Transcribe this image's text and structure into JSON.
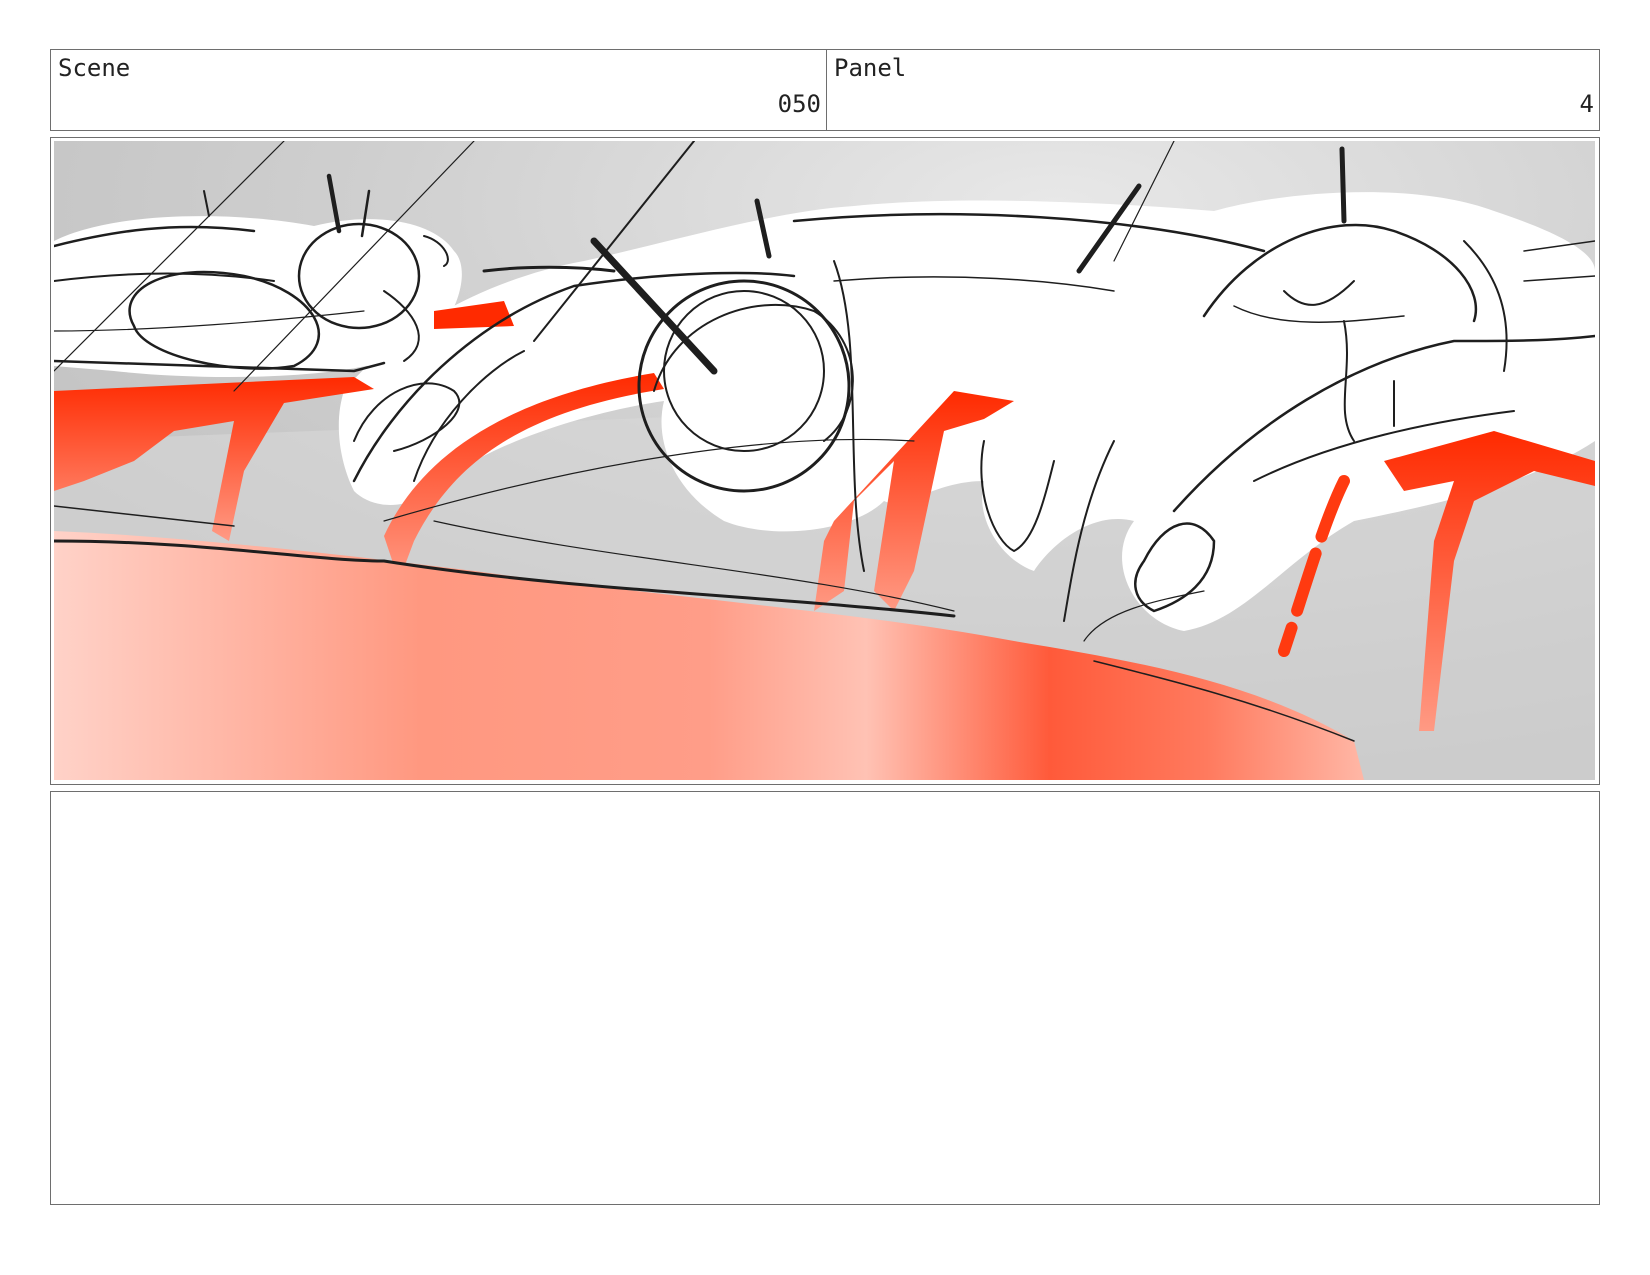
{
  "header": {
    "scene_label": "Scene",
    "scene_value": "050",
    "panel_label": "Panel",
    "panel_value": "4"
  },
  "colors": {
    "border": "#6e6e6e",
    "blood_red": "#ff2a00",
    "sketch_bg": "#c8c8c8",
    "sketch_line": "#1a1a1a"
  },
  "notes": {
    "text": ""
  }
}
